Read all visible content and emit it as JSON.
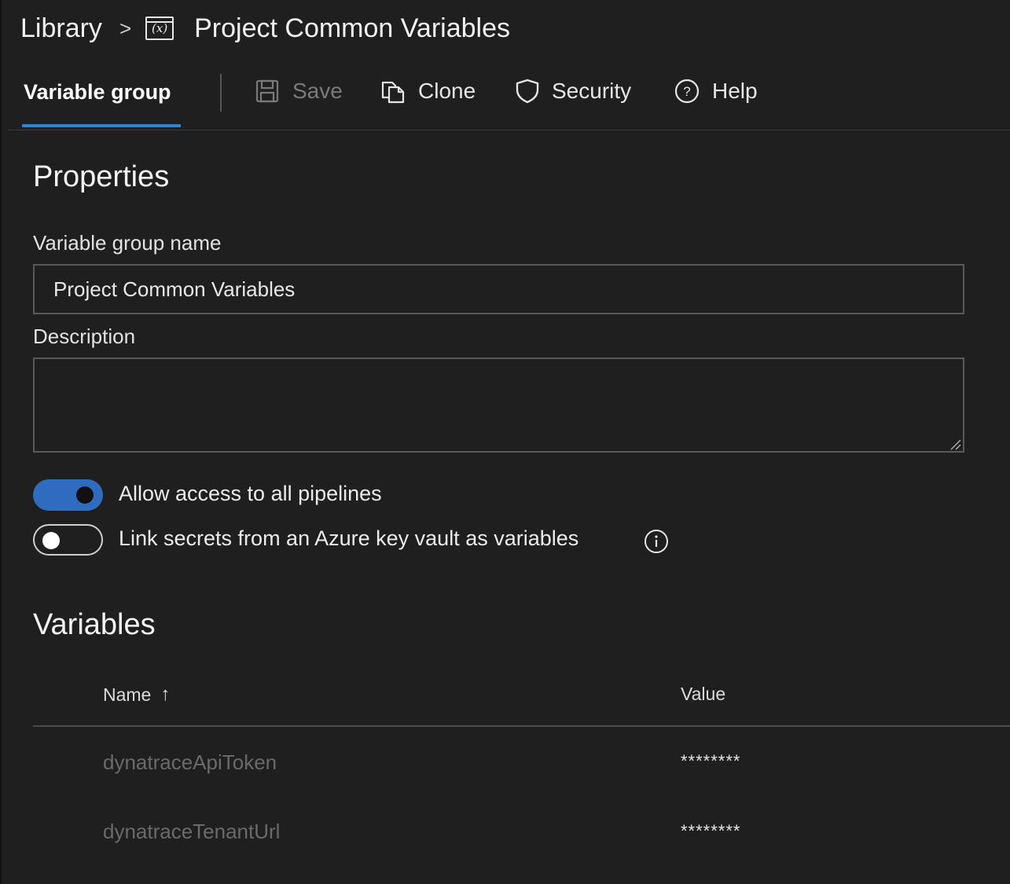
{
  "breadcrumb": {
    "root": "Library",
    "separator": ">",
    "icon": "variable-group-icon",
    "title": "Project Common Variables"
  },
  "toolbar": {
    "active_tab": "Variable group",
    "save": "Save",
    "clone": "Clone",
    "security": "Security",
    "help": "Help"
  },
  "properties": {
    "heading": "Properties",
    "name_label": "Variable group name",
    "name_value": "Project Common Variables",
    "description_label": "Description",
    "description_value": "",
    "allow_access_label": "Allow access to all pipelines",
    "allow_access_on": true,
    "link_secrets_label": "Link secrets from an Azure key vault as variables",
    "link_secrets_on": false
  },
  "variables": {
    "heading": "Variables",
    "columns": {
      "name": "Name",
      "sort_indicator": "↑",
      "value": "Value"
    },
    "rows": [
      {
        "name": "dynatraceApiToken",
        "value": "********"
      },
      {
        "name": "dynatraceTenantUrl",
        "value": "********"
      }
    ]
  },
  "colors": {
    "background": "#1f1f1f",
    "accent": "#2f83d4",
    "toggle_on": "#2f6cc0"
  }
}
